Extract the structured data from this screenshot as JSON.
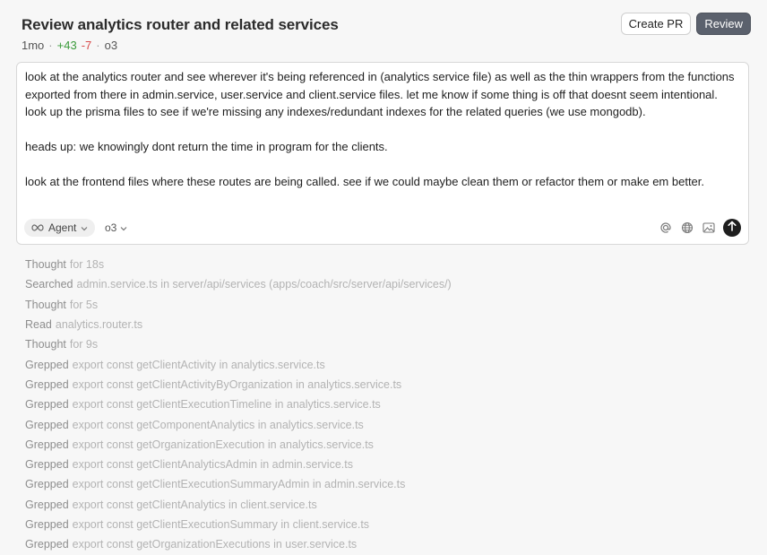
{
  "header": {
    "title": "Review analytics router and related services",
    "age": "1mo",
    "additions": "+43",
    "deletions": "-7",
    "model": "o3",
    "create_pr_label": "Create PR",
    "review_label": "Review"
  },
  "prompt": {
    "paragraphs": [
      "look at the analytics router and see wherever it's being referenced in (analytics service file) as well as the thin wrappers from the functions exported from there in admin.service, user.service and client.service files. let me know if some thing is off that doesnt seem intentional. look up the prisma files to see if we're missing any indexes/redundant indexes for the related queries (we use mongodb).",
      "heads up: we knowingly dont return the time in program for the clients.",
      "look at the frontend files where these routes are being called. see if we could maybe clean them or refactor them or make em better."
    ],
    "agent_label": "Agent",
    "model_label": "o3",
    "icons": [
      "infinity-icon",
      "chevron-down-icon",
      "at-icon",
      "globe-icon",
      "image-icon",
      "arrow-up-icon"
    ]
  },
  "log": [
    {
      "verb": "Thought",
      "detail": "for 18s"
    },
    {
      "verb": "Searched",
      "detail": "admin.service.ts in server/api/services (apps/coach/src/server/api/services/)"
    },
    {
      "verb": "Thought",
      "detail": "for 5s"
    },
    {
      "verb": "Read",
      "detail": "analytics.router.ts"
    },
    {
      "verb": "Thought",
      "detail": "for 9s"
    },
    {
      "verb": "Grepped",
      "detail": "export const getClientActivity in analytics.service.ts"
    },
    {
      "verb": "Grepped",
      "detail": "export const getClientActivityByOrganization in analytics.service.ts"
    },
    {
      "verb": "Grepped",
      "detail": "export const getClientExecutionTimeline in analytics.service.ts"
    },
    {
      "verb": "Grepped",
      "detail": "export const getComponentAnalytics in analytics.service.ts"
    },
    {
      "verb": "Grepped",
      "detail": "export const getOrganizationExecution in analytics.service.ts"
    },
    {
      "verb": "Grepped",
      "detail": "export const getClientAnalyticsAdmin in admin.service.ts"
    },
    {
      "verb": "Grepped",
      "detail": "export const getClientExecutionSummaryAdmin in admin.service.ts"
    },
    {
      "verb": "Grepped",
      "detail": "export const getClientAnalytics in client.service.ts"
    },
    {
      "verb": "Grepped",
      "detail": "export const getClientExecutionSummary in client.service.ts"
    },
    {
      "verb": "Grepped",
      "detail": "export const getOrganizationExecutions in user.service.ts"
    }
  ]
}
